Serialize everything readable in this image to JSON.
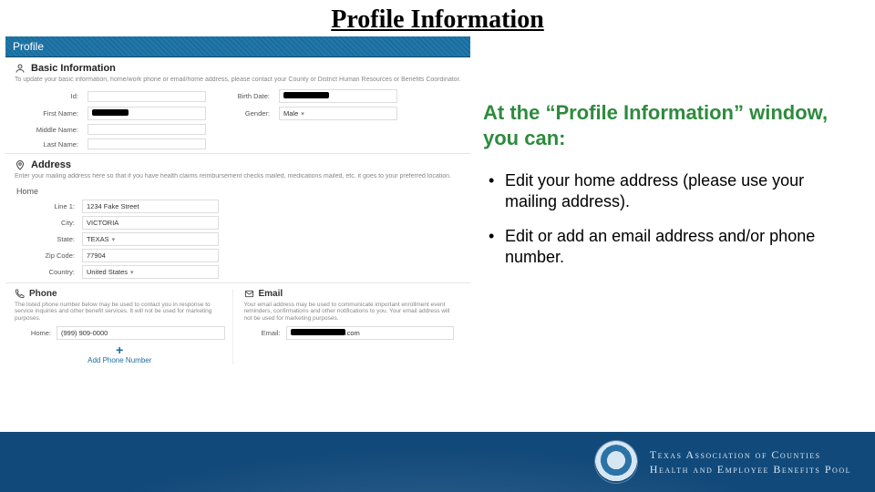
{
  "slide": {
    "title": "Profile Information"
  },
  "instructions": {
    "heading": "At the “Profile Information” window, you can:",
    "bullets": [
      "Edit your home address (please use your mailing address).",
      "Edit or add an email address and/or phone number."
    ]
  },
  "screenshot": {
    "header_title": "Profile",
    "basic": {
      "title": "Basic Information",
      "desc": "To update your basic information, home/work phone or email/home address, please contact your County or District Human Resources or Benefits Coordinator.",
      "fields": {
        "id_label": "Id:",
        "id_value": "",
        "birthdate_label": "Birth Date:",
        "birthdate_value_redacted": true,
        "firstname_label": "First Name:",
        "firstname_value_redacted": true,
        "gender_label": "Gender:",
        "gender_value": "Male",
        "middlename_label": "Middle Name:",
        "middlename_value": "",
        "lastname_label": "Last Name:",
        "lastname_value": ""
      }
    },
    "address": {
      "title": "Address",
      "desc": "Enter your mailing address here so that if you have health claims reimbursement checks mailed, medications mailed, etc. it goes to your preferred location.",
      "subtitle": "Home",
      "fields": {
        "line1_label": "Line 1:",
        "line1_value": "1234 Fake Street",
        "city_label": "City:",
        "city_value": "VICTORIA",
        "state_label": "State:",
        "state_value": "TEXAS",
        "zip_label": "Zip Code:",
        "zip_value": "77904",
        "country_label": "Country:",
        "country_value": "United States"
      }
    },
    "phone": {
      "title": "Phone",
      "desc": "The listed phone number below may be used to contact you in response to service inquiries and other benefit services. It will not be used for marketing purposes.",
      "field_label": "Home:",
      "field_value": "(999) 909-0000",
      "add_label": "Add Phone Number"
    },
    "email": {
      "title": "Email",
      "desc": "Your email address may be used to communicate important enrollment event reminders, confirmations and other notifications to you. Your email address will not be used for marketing purposes.",
      "field_label": "Email:",
      "field_value_suffix": ".com"
    }
  },
  "footer": {
    "org_line1": "Texas Association of Counties",
    "org_line2": "Health and Employee Benefits Pool"
  }
}
